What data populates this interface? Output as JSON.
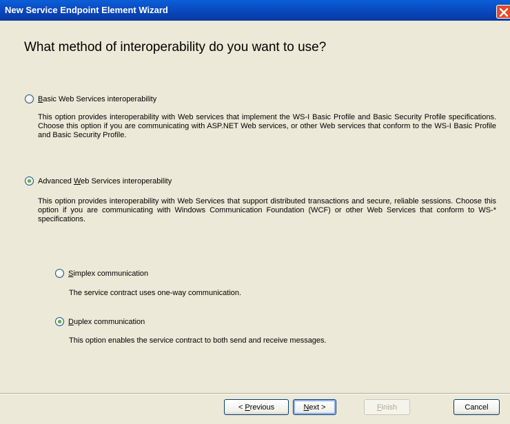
{
  "window": {
    "title": "New Service Endpoint Element Wizard",
    "close_label": "×"
  },
  "heading": "What method of interoperability do you want to use?",
  "options": {
    "basic": {
      "label_prefix": "",
      "label_mnemonic": "B",
      "label_rest": "asic Web Services interoperability",
      "checked": false,
      "description": "This option provides interoperability with Web services that implement the WS-I Basic Profile and Basic Security Profile specifications. Choose this option if you are communicating with ASP.NET Web services, or other Web services that conform to the WS-I Basic Profile and Basic Security Profile."
    },
    "advanced": {
      "label_prefix": "Advanced ",
      "label_mnemonic": "W",
      "label_rest": "eb Services interoperability",
      "checked": true,
      "description": "This option provides interoperability with Web Services that support distributed transactions and secure, reliable sessions. Choose this option if you are communicating with Windows Communication Foundation (WCF) or other Web Services that conform to WS-* specifications."
    },
    "simplex": {
      "label_mnemonic": "S",
      "label_rest": "implex communication",
      "checked": false,
      "description": "The service contract uses one-way communication."
    },
    "duplex": {
      "label_mnemonic": "D",
      "label_rest": "uplex communication",
      "checked": true,
      "description": "This option enables the service contract to both send and receive messages."
    }
  },
  "buttons": {
    "previous": {
      "prefix": "< ",
      "mnemonic": "P",
      "rest": "revious"
    },
    "next": {
      "mnemonic": "N",
      "rest": "ext >"
    },
    "finish": {
      "mnemonic": "F",
      "rest": "inish",
      "enabled": false
    },
    "cancel": {
      "label": "Cancel"
    }
  },
  "colors": {
    "titlebar": "#0a4dc4",
    "dialog_bg": "#ece9d8",
    "close_button": "#e34b2a",
    "radio_dot": "#2d8f2a"
  }
}
